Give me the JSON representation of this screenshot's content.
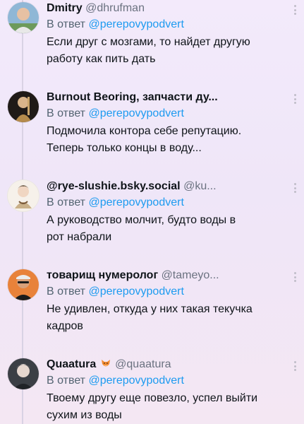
{
  "replies": [
    {
      "name": "Dmitry",
      "handle": "@dhrufman",
      "reply_prefix": "В ответ",
      "reply_to": "@perepovypodvert",
      "text_lines": [
        "Если друг с мозгами, то найдет другую",
        "работу как пить дать"
      ],
      "avatar": "avatar-dmitry"
    },
    {
      "name": "Burnout Beoring, запчасти ду...",
      "handle": "",
      "reply_prefix": "В ответ",
      "reply_to": "@perepovypodvert",
      "text_lines": [
        "Подмочила контора себе репутацию.",
        "Теперь только концы в воду..."
      ],
      "avatar": "avatar-burnout"
    },
    {
      "name": "@rye-slushie.bsky.social",
      "handle": "@ku...",
      "reply_prefix": "В ответ",
      "reply_to": "@perepovypodvert",
      "text_lines": [
        "А руководство молчит, будто воды в",
        "рот набрали"
      ],
      "avatar": "avatar-rye"
    },
    {
      "name": "товарищ нумеролог",
      "handle": "@tameyo...",
      "reply_prefix": "В ответ",
      "reply_to": "@perepovypodvert",
      "text_lines": [
        "Не удивлен, откуда у них такая текучка",
        "кадров"
      ],
      "avatar": "avatar-numerolog"
    },
    {
      "name": "Quaatura",
      "handle": "@quaatura",
      "reply_prefix": "В ответ",
      "reply_to": "@perepovypodvert",
      "text_lines": [
        "Твоему другу еще повезло, успел выйти",
        "сухим из воды"
      ],
      "avatar": "avatar-quaatura",
      "emoji": "fox-icon"
    }
  ]
}
